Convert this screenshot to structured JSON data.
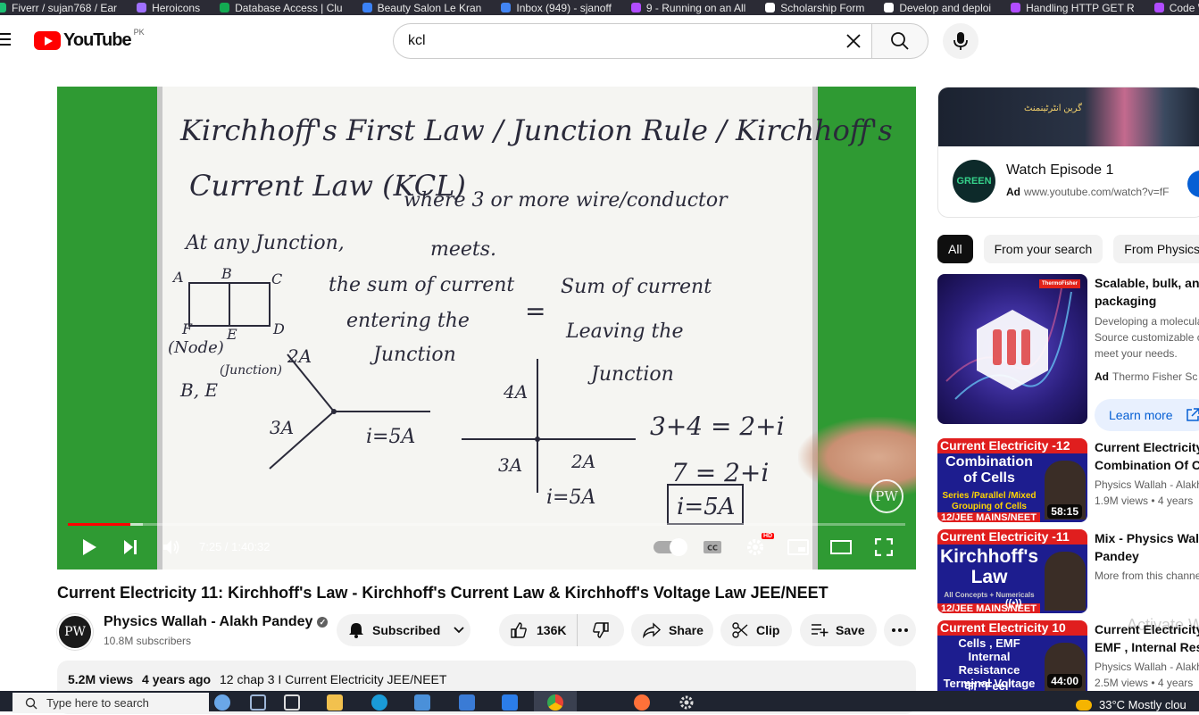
{
  "bookmarks": [
    {
      "label": "Fiverr / sujan768 / Ear",
      "color": "#1dbf73"
    },
    {
      "label": "Heroicons",
      "color": "#a070ff"
    },
    {
      "label": "Database Access | Clu",
      "color": "#13aa52"
    },
    {
      "label": "Beauty Salon Le Kran",
      "color": "#3b82f6"
    },
    {
      "label": "Inbox (949) - sjanoff",
      "color": "#4285f4"
    },
    {
      "label": "9 - Running on an All",
      "color": "#b14cff"
    },
    {
      "label": "Scholarship Form",
      "color": "#ffffff"
    },
    {
      "label": "Develop and deploi",
      "color": "#ffffff"
    },
    {
      "label": "Handling HTTP GET R",
      "color": "#b14cff"
    },
    {
      "label": "Code W",
      "color": "#b14cff"
    }
  ],
  "masthead": {
    "logo_text": "YouTube",
    "country_code": "PK",
    "search_value": "kcl",
    "search_placeholder": "Search"
  },
  "player": {
    "time_display": "7:25 / 1:40:32",
    "progress_played": 0.075,
    "progress_buffered": 0.09,
    "hd_badge": "HD",
    "watermark": "PW",
    "board": {
      "line1": "Kirchhoff's First Law / Junction Rule / Kirchhoff's",
      "line2": "Current Law (KCL)",
      "where": "where 3 or more wire/conductor",
      "meets": "meets.",
      "at_any": "At any Junction,",
      "sum_in": "the sum of current",
      "entering": "entering the",
      "junction1": "Junction",
      "equals": "=",
      "sum_out": "Sum of current",
      "leaving": "Leaving the",
      "junction2": "Junction",
      "node": "(Node)",
      "junction_label": "(Junction)",
      "be": "B, E",
      "a2": "2A",
      "a3": "3A",
      "i5": "i=5A",
      "a4": "4A",
      "a3b": "3A",
      "a2b": "2A",
      "i5b": "i=5A",
      "eq1": "3+4 = 2+i",
      "eq2": "7 = 2+i",
      "eq3": "i=5A",
      "node_labels": [
        "A",
        "B",
        "C",
        "F",
        "E",
        "D"
      ]
    }
  },
  "video": {
    "title": "Current Electricity 11: Kirchhoff's Law - Kirchhoff's Current Law & Kirchhoff's Voltage Law JEE/NEET",
    "channel": "Physics Wallah - Alakh Pandey",
    "subscribers": "10.8M subscribers",
    "subscribed_label": "Subscribed",
    "likes": "136K",
    "share_label": "Share",
    "clip_label": "Clip",
    "save_label": "Save",
    "views": "5.2M views",
    "age": "4 years ago",
    "tags": "12 chap 3 I Current Electricity JEE/NEET"
  },
  "ad": {
    "title": "Watch Episode 1",
    "label": "Ad",
    "url": "www.youtube.com/watch?v=fF",
    "logo": "GREEN",
    "banner_text": "گرین انٹرٹینمنٹ"
  },
  "chips": [
    "All",
    "From your search",
    "From Physics Wallah"
  ],
  "recommendations": [
    {
      "title_line1": "Scalable, bulk, and",
      "title_line2": "packaging",
      "desc1": "Developing a molecular",
      "desc2": "Source customizable c",
      "desc3": "meet your needs.",
      "ad_label": "Ad",
      "advertiser": "Thermo Fisher Sc",
      "cta": "Learn more",
      "brand": "ThermoFisher"
    },
    {
      "title_line1": "Current Electricity",
      "title_line2": "Combination Of Ce",
      "channel": "Physics Wallah - Alakh",
      "views": "1.9M views",
      "age": "4 years",
      "duration": "58:15",
      "thumb_top": "Current Electricity -12",
      "thumb_main": "Combination of Cells",
      "thumb_sub": "Series /Parallel /Mixed Grouping of Cells",
      "thumb_bottom": "12/JEE MAINS/NEET"
    },
    {
      "title_line1": "Mix - Physics Walla",
      "title_line2": "Pandey",
      "meta": "More from this channe",
      "thumb_top": "Current Electricity -11",
      "thumb_main": "Kirchhoff's Law",
      "thumb_sub": "All Concepts + Numericals",
      "thumb_bottom": "12/JEE MAINS/NEET"
    },
    {
      "title_line1": "Current Electricity",
      "title_line2": "EMF , Internal Resi",
      "channel": "Physics Wallah - Alakh",
      "views": "2.5M views",
      "age": "4 years",
      "duration": "44:00",
      "thumb_top": "Current Electricity 10",
      "thumb_main": "Cells , EMF Internal Resistance Terminal Voltage",
      "thumb_sub": "का \"Feel\""
    }
  ],
  "activate_watermark": "Activate W",
  "taskbar": {
    "search_placeholder": "Type here to search",
    "weather": "33°C  Mostly clou"
  }
}
